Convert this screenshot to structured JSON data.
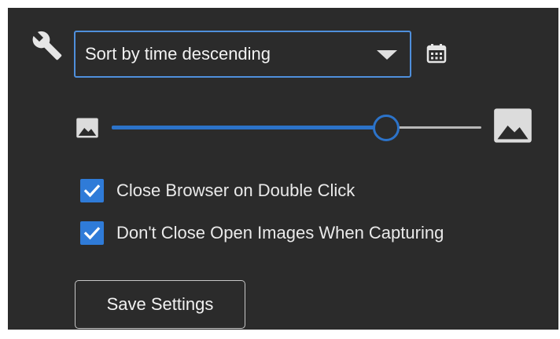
{
  "settings": {
    "sort": {
      "selected": "Sort by time descending"
    },
    "thumbnail_size": {
      "value_fraction": 0.74
    },
    "checkboxes": [
      {
        "label": "Close Browser on Double Click",
        "checked": true
      },
      {
        "label": "Don't Close Open Images When Capturing",
        "checked": true
      }
    ],
    "save_label": "Save Settings"
  },
  "icons": {
    "settings": "wrench-icon",
    "calendar": "calendar-icon",
    "small_thumb": "image-small-icon",
    "large_thumb": "image-large-icon",
    "checkmark": "checkmark-icon",
    "dropdown": "chevron-down-icon"
  },
  "colors": {
    "panel_background": "#2b2b2b",
    "accent": "#2c73c9",
    "checkbox": "#2f7bd8",
    "text": "#eaeaea"
  }
}
